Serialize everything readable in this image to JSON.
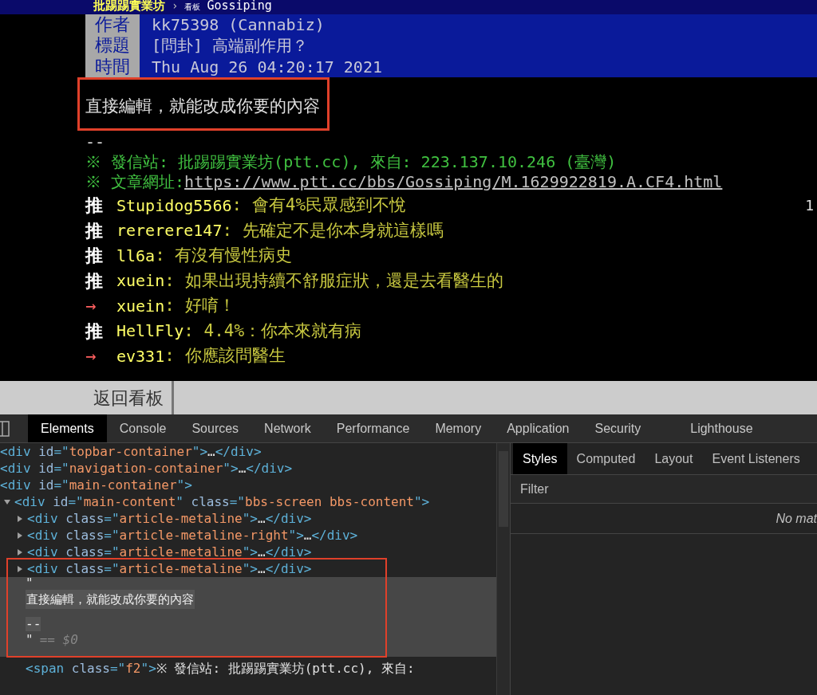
{
  "topbar": {
    "site": "批踢踢實業坊",
    "separator": "›",
    "board_label": "看板",
    "board": "Gossiping"
  },
  "meta": [
    {
      "label": "作者",
      "value": "kk75398 (Cannabiz)"
    },
    {
      "label": "標題",
      "value": "[問卦] 高端副作用？"
    },
    {
      "label": "時間",
      "value": "Thu Aug 26 04:20:17 2021"
    }
  ],
  "article": {
    "body": "直接編輯，就能改成你要的內容",
    "signature": "--",
    "source": "※ 發信站: 批踢踢實業坊(ptt.cc), 來自: 223.137.10.246 (臺灣)",
    "url_label": "※ 文章網址: ",
    "url": "https://www.ptt.cc/bbs/Gossiping/M.1629922819.A.CF4.html"
  },
  "comments": [
    {
      "kind": "push",
      "tag": "推",
      "user": "Stupidog5566",
      "content": ": 會有4%民眾感到不悅",
      "right_text": "1"
    },
    {
      "kind": "push",
      "tag": "推",
      "user": "rererere147",
      "content": ": 先確定不是你本身就這樣嗎"
    },
    {
      "kind": "push",
      "tag": "推",
      "user": "ll6a",
      "content": ": 有沒有慢性病史"
    },
    {
      "kind": "push",
      "tag": "推",
      "user": "xuein",
      "content": ": 如果出現持續不舒服症狀，還是去看醫生的"
    },
    {
      "kind": "arrow",
      "tag": "→",
      "user": "xuein",
      "content": ": 好唷！"
    },
    {
      "kind": "push",
      "tag": "推",
      "user": "HellFly",
      "content": ": 4.4%：你本來就有病"
    },
    {
      "kind": "arrow",
      "tag": "→",
      "user": "ev331",
      "content": ": 你應該問醫生"
    }
  ],
  "back_button": "返回看板",
  "devtools": {
    "tabs": [
      {
        "label": "Elements",
        "selected": true
      },
      {
        "label": "Console",
        "selected": false
      },
      {
        "label": "Sources",
        "selected": false
      },
      {
        "label": "Network",
        "selected": false
      },
      {
        "label": "Performance",
        "selected": false
      },
      {
        "label": "Memory",
        "selected": false
      },
      {
        "label": "Application",
        "selected": false
      },
      {
        "label": "Security",
        "selected": false
      },
      {
        "label": "Lighthouse",
        "selected": false
      }
    ],
    "dom": [
      {
        "toggle": false,
        "segments": [
          {
            "kind": "tag",
            "text": "<div "
          },
          {
            "kind": "attr",
            "text": "id"
          },
          {
            "kind": "tag",
            "text": "=\""
          },
          {
            "kind": "value",
            "text": "topbar-container"
          },
          {
            "kind": "tag",
            "text": "\">"
          },
          {
            "kind": "text",
            "text": "…"
          },
          {
            "kind": "tag",
            "text": "</div>"
          }
        ]
      },
      {
        "toggle": false,
        "segments": [
          {
            "kind": "tag",
            "text": "<div "
          },
          {
            "kind": "attr",
            "text": "id"
          },
          {
            "kind": "tag",
            "text": "=\""
          },
          {
            "kind": "value",
            "text": "navigation-container"
          },
          {
            "kind": "tag",
            "text": "\">"
          },
          {
            "kind": "text",
            "text": "…"
          },
          {
            "kind": "tag",
            "text": "</div>"
          }
        ]
      },
      {
        "toggle": false,
        "segments": [
          {
            "kind": "tag",
            "text": "<div "
          },
          {
            "kind": "attr",
            "text": "id"
          },
          {
            "kind": "tag",
            "text": "=\""
          },
          {
            "kind": "value",
            "text": "main-container"
          },
          {
            "kind": "tag",
            "text": "\">"
          }
        ]
      },
      {
        "toggle": true,
        "expanded": true,
        "segments": [
          {
            "kind": "tag",
            "text": "<div "
          },
          {
            "kind": "attr",
            "text": "id"
          },
          {
            "kind": "tag",
            "text": "=\""
          },
          {
            "kind": "value",
            "text": "main-content"
          },
          {
            "kind": "tag",
            "text": "\" "
          },
          {
            "kind": "attr",
            "text": "class"
          },
          {
            "kind": "tag",
            "text": "=\""
          },
          {
            "kind": "value",
            "text": "bbs-screen bbs-content"
          },
          {
            "kind": "tag",
            "text": "\">"
          }
        ],
        "children": [
          {
            "toggle": true,
            "expanded": false,
            "segments": [
              {
                "kind": "tag",
                "text": "<div "
              },
              {
                "kind": "attr",
                "text": "class"
              },
              {
                "kind": "tag",
                "text": "=\""
              },
              {
                "kind": "value",
                "text": "article-metaline"
              },
              {
                "kind": "tag",
                "text": "\">"
              },
              {
                "kind": "text",
                "text": "…"
              },
              {
                "kind": "tag",
                "text": "</div>"
              }
            ]
          },
          {
            "toggle": true,
            "expanded": false,
            "segments": [
              {
                "kind": "tag",
                "text": "<div "
              },
              {
                "kind": "attr",
                "text": "class"
              },
              {
                "kind": "tag",
                "text": "=\""
              },
              {
                "kind": "value",
                "text": "article-metaline-right"
              },
              {
                "kind": "tag",
                "text": "\">"
              },
              {
                "kind": "text",
                "text": "…"
              },
              {
                "kind": "tag",
                "text": "</div>"
              }
            ]
          },
          {
            "toggle": true,
            "expanded": false,
            "segments": [
              {
                "kind": "tag",
                "text": "<div "
              },
              {
                "kind": "attr",
                "text": "class"
              },
              {
                "kind": "tag",
                "text": "=\""
              },
              {
                "kind": "value",
                "text": "article-metaline"
              },
              {
                "kind": "tag",
                "text": "\">"
              },
              {
                "kind": "text",
                "text": "…"
              },
              {
                "kind": "tag",
                "text": "</div>"
              }
            ]
          },
          {
            "toggle": true,
            "expanded": false,
            "segments": [
              {
                "kind": "tag",
                "text": "<div "
              },
              {
                "kind": "attr",
                "text": "class"
              },
              {
                "kind": "tag",
                "text": "=\""
              },
              {
                "kind": "value",
                "text": "article-metaline"
              },
              {
                "kind": "tag",
                "text": "\">"
              },
              {
                "kind": "text",
                "text": "…"
              },
              {
                "kind": "tag",
                "text": "</div>"
              }
            ]
          }
        ]
      }
    ],
    "text_node": {
      "quote": "\"",
      "text": "直接編輯，就能改成你要的內容",
      "dashes": "--",
      "closing_quote": "\"",
      "selection_marker": "== $0"
    },
    "last_line": [
      {
        "kind": "tag",
        "text": "<span "
      },
      {
        "kind": "attr",
        "text": "class"
      },
      {
        "kind": "tag",
        "text": "=\""
      },
      {
        "kind": "value",
        "text": "f2"
      },
      {
        "kind": "tag",
        "text": "\">"
      },
      {
        "kind": "text",
        "text": "※ 發信站: 批踢踢實業坊(ptt.cc), 來自:"
      }
    ],
    "side_tabs": [
      {
        "label": "Styles",
        "selected": true
      },
      {
        "label": "Computed",
        "selected": false
      },
      {
        "label": "Layout",
        "selected": false
      },
      {
        "label": "Event Listeners",
        "selected": false
      }
    ],
    "filter": {
      "placeholder": "Filter"
    },
    "empty_message": "No mat"
  }
}
